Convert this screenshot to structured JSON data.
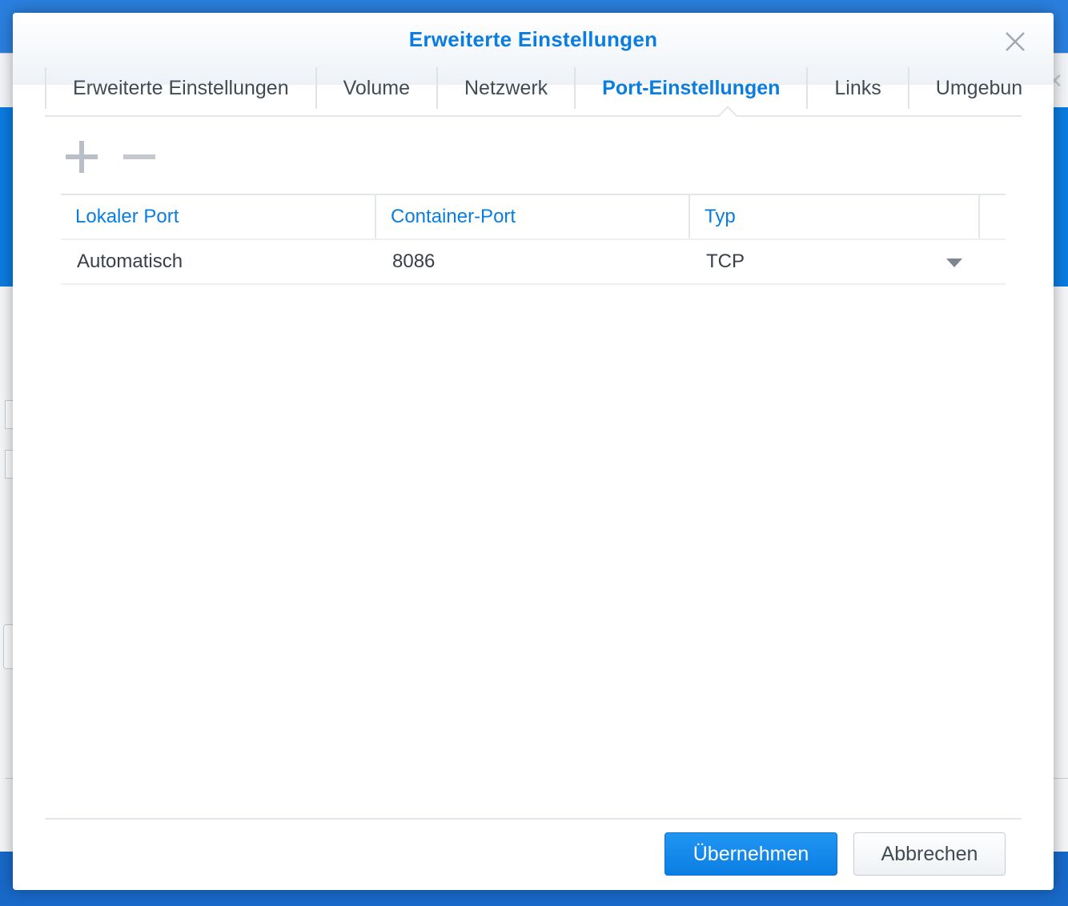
{
  "dialog": {
    "title": "Erweiterte Einstellungen",
    "close_icon": "close-icon"
  },
  "tabs": [
    {
      "label": "Erweiterte Einstellungen",
      "active": false
    },
    {
      "label": "Volume",
      "active": false
    },
    {
      "label": "Netzwerk",
      "active": false
    },
    {
      "label": "Port-Einstellungen",
      "active": true
    },
    {
      "label": "Links",
      "active": false
    },
    {
      "label": "Umgebung",
      "active": false
    }
  ],
  "toolbar": {
    "add_icon": "plus-icon",
    "remove_icon": "minus-icon"
  },
  "table": {
    "columns": [
      "Lokaler Port",
      "Container-Port",
      "Typ"
    ],
    "rows": [
      {
        "local_port": "Automatisch",
        "container_port": "8086",
        "type": "TCP"
      }
    ]
  },
  "footer": {
    "apply_label": "Übernehmen",
    "cancel_label": "Abbrechen"
  },
  "colors": {
    "accent": "#0a7de0",
    "background_blue": "#1b72d6"
  }
}
